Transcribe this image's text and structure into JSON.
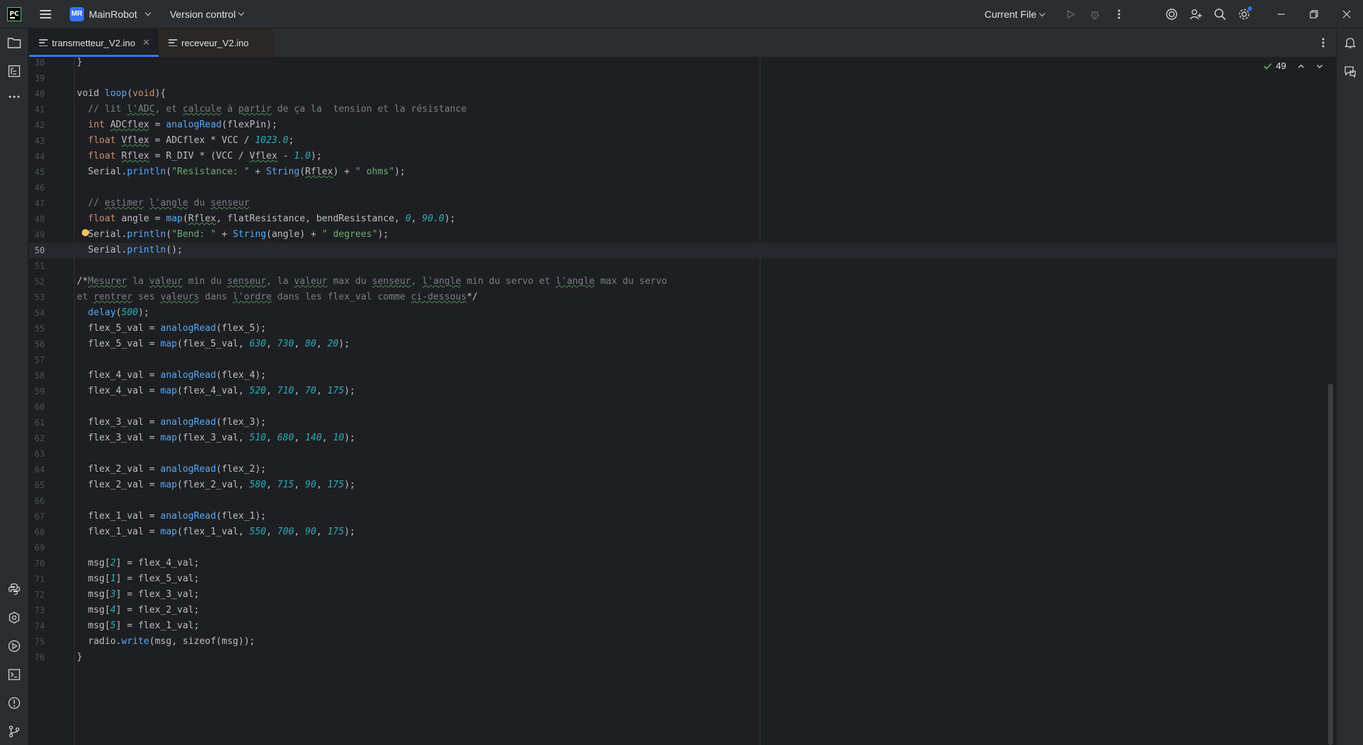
{
  "titlebar": {
    "app_logo": "PC",
    "project_badge": "MR",
    "project_name": "MainRobot",
    "vcs_label": "Version control",
    "run_config": "Current File"
  },
  "tabs": [
    {
      "label": "transmetteur_V2.ino",
      "active": true
    },
    {
      "label": "receveur_V2.ino",
      "active": false
    }
  ],
  "editor": {
    "inspection_count": "49",
    "current_line": "50",
    "lines": [
      {
        "n": "38",
        "t": [
          [
            "}",
            ""
          ]
        ]
      },
      {
        "n": "39",
        "t": []
      },
      {
        "n": "40",
        "t": [
          [
            "void ",
            ""
          ],
          [
            "loop",
            "fn"
          ],
          [
            "(",
            ""
          ],
          [
            "void",
            "kw"
          ],
          [
            "){",
            ""
          ]
        ]
      },
      {
        "n": "41",
        "t": [
          [
            "  // lit ",
            "cmt"
          ],
          [
            "l'ADC",
            "cmt ul"
          ],
          [
            ", et ",
            "cmt"
          ],
          [
            "calcule",
            "cmt ul"
          ],
          [
            " à ",
            "cmt"
          ],
          [
            "partir",
            "cmt ul"
          ],
          [
            " de ça la  tension et la résistance",
            "cmt"
          ]
        ]
      },
      {
        "n": "42",
        "t": [
          [
            "  ",
            ""
          ],
          [
            "int",
            "kw"
          ],
          [
            " ",
            ""
          ],
          [
            "ADCflex",
            "ul"
          ],
          [
            " = ",
            ""
          ],
          [
            "analogRead",
            "fn"
          ],
          [
            "(flexPin);",
            ""
          ]
        ]
      },
      {
        "n": "43",
        "t": [
          [
            "  ",
            ""
          ],
          [
            "float",
            "kw"
          ],
          [
            " ",
            ""
          ],
          [
            "Vflex",
            "ul"
          ],
          [
            " = ADCflex * VCC / ",
            ""
          ],
          [
            "1023.0",
            "num"
          ],
          [
            ";",
            ""
          ]
        ]
      },
      {
        "n": "44",
        "t": [
          [
            "  ",
            ""
          ],
          [
            "float",
            "kw"
          ],
          [
            " ",
            ""
          ],
          [
            "Rflex",
            "ul"
          ],
          [
            " = R_DIV * (VCC / ",
            ""
          ],
          [
            "Vflex",
            "ul"
          ],
          [
            " - ",
            ""
          ],
          [
            "1.0",
            "num"
          ],
          [
            ");",
            ""
          ]
        ]
      },
      {
        "n": "45",
        "t": [
          [
            "  Serial.",
            ""
          ],
          [
            "println",
            "fn"
          ],
          [
            "(",
            ""
          ],
          [
            "\"Resistance: \"",
            "str"
          ],
          [
            " + ",
            ""
          ],
          [
            "String",
            "fn"
          ],
          [
            "(",
            ""
          ],
          [
            "Rflex",
            "ul"
          ],
          [
            ") + ",
            ""
          ],
          [
            "\" ohms\"",
            "str"
          ],
          [
            ");",
            ""
          ]
        ]
      },
      {
        "n": "46",
        "t": []
      },
      {
        "n": "47",
        "t": [
          [
            "  // ",
            "cmt"
          ],
          [
            "estimer",
            "cmt ul"
          ],
          [
            " ",
            "cmt"
          ],
          [
            "l'angle",
            "cmt ul"
          ],
          [
            " du ",
            "cmt"
          ],
          [
            "senseur",
            "cmt ul"
          ]
        ]
      },
      {
        "n": "48",
        "t": [
          [
            "  ",
            ""
          ],
          [
            "float",
            "kw"
          ],
          [
            " angle = ",
            ""
          ],
          [
            "map",
            "fn"
          ],
          [
            "(",
            ""
          ],
          [
            "Rflex",
            "ul"
          ],
          [
            ", flatResistance, bendResistance, ",
            ""
          ],
          [
            "0",
            "num"
          ],
          [
            ", ",
            ""
          ],
          [
            "90.0",
            "num"
          ],
          [
            ");",
            ""
          ]
        ]
      },
      {
        "n": "49",
        "t": [
          [
            "  Serial.",
            ""
          ],
          [
            "println",
            "fn"
          ],
          [
            "(",
            ""
          ],
          [
            "\"Bend: \"",
            "str"
          ],
          [
            " + ",
            ""
          ],
          [
            "String",
            "fn"
          ],
          [
            "(angle) + ",
            ""
          ],
          [
            "\" degrees\"",
            "str"
          ],
          [
            ");",
            ""
          ]
        ]
      },
      {
        "n": "50",
        "t": [
          [
            "  Serial.",
            ""
          ],
          [
            "println",
            "fn"
          ],
          [
            "();",
            ""
          ]
        ]
      },
      {
        "n": "51",
        "t": []
      },
      {
        "n": "52",
        "t": [
          [
            "/*",
            ""
          ],
          [
            "Mesurer",
            "cmt ul"
          ],
          [
            " la ",
            "cmt"
          ],
          [
            "valeur",
            "cmt ul"
          ],
          [
            " min du ",
            "cmt"
          ],
          [
            "senseur",
            "cmt ul"
          ],
          [
            ", la ",
            "cmt"
          ],
          [
            "valeur",
            "cmt ul"
          ],
          [
            " max du ",
            "cmt"
          ],
          [
            "senseur",
            "cmt ul"
          ],
          [
            ", ",
            "cmt"
          ],
          [
            "l'angle",
            "cmt ul"
          ],
          [
            " min du servo et ",
            "cmt"
          ],
          [
            "l'angle",
            "cmt ul"
          ],
          [
            " max du servo",
            "cmt"
          ]
        ]
      },
      {
        "n": "53",
        "t": [
          [
            "et ",
            "cmt"
          ],
          [
            "rentrer",
            "cmt ul"
          ],
          [
            " ses ",
            "cmt"
          ],
          [
            "valeurs",
            "cmt ul"
          ],
          [
            " dans ",
            "cmt"
          ],
          [
            "l'ordre",
            "cmt ul"
          ],
          [
            " dans les flex_val comme ",
            "cmt"
          ],
          [
            "ci-dessous",
            "cmt ul"
          ],
          [
            "*/",
            ""
          ]
        ]
      },
      {
        "n": "54",
        "t": [
          [
            "  ",
            ""
          ],
          [
            "delay",
            "fn"
          ],
          [
            "(",
            ""
          ],
          [
            "500",
            "num"
          ],
          [
            ");",
            ""
          ]
        ]
      },
      {
        "n": "55",
        "t": [
          [
            "  flex_5_val = ",
            ""
          ],
          [
            "analogRead",
            "fn"
          ],
          [
            "(flex_5);",
            ""
          ]
        ]
      },
      {
        "n": "56",
        "t": [
          [
            "  flex_5_val = ",
            ""
          ],
          [
            "map",
            "fn"
          ],
          [
            "(flex_5_val, ",
            ""
          ],
          [
            "630",
            "num"
          ],
          [
            ", ",
            ""
          ],
          [
            "730",
            "num"
          ],
          [
            ", ",
            ""
          ],
          [
            "80",
            "num"
          ],
          [
            ", ",
            ""
          ],
          [
            "20",
            "num"
          ],
          [
            ");",
            ""
          ]
        ]
      },
      {
        "n": "57",
        "t": []
      },
      {
        "n": "58",
        "t": [
          [
            "  flex_4_val = ",
            ""
          ],
          [
            "analogRead",
            "fn"
          ],
          [
            "(flex_4);",
            ""
          ]
        ]
      },
      {
        "n": "59",
        "t": [
          [
            "  flex_4_val = ",
            ""
          ],
          [
            "map",
            "fn"
          ],
          [
            "(flex_4_val, ",
            ""
          ],
          [
            "520",
            "num"
          ],
          [
            ", ",
            ""
          ],
          [
            "710",
            "num"
          ],
          [
            ", ",
            ""
          ],
          [
            "70",
            "num"
          ],
          [
            ", ",
            ""
          ],
          [
            "175",
            "num"
          ],
          [
            ");",
            ""
          ]
        ]
      },
      {
        "n": "60",
        "t": []
      },
      {
        "n": "61",
        "t": [
          [
            "  flex_3_val = ",
            ""
          ],
          [
            "analogRead",
            "fn"
          ],
          [
            "(flex_3);",
            ""
          ]
        ]
      },
      {
        "n": "62",
        "t": [
          [
            "  flex_3_val = ",
            ""
          ],
          [
            "map",
            "fn"
          ],
          [
            "(flex_3_val, ",
            ""
          ],
          [
            "510",
            "num"
          ],
          [
            ", ",
            ""
          ],
          [
            "680",
            "num"
          ],
          [
            ", ",
            ""
          ],
          [
            "140",
            "num"
          ],
          [
            ", ",
            ""
          ],
          [
            "10",
            "num"
          ],
          [
            ");",
            ""
          ]
        ]
      },
      {
        "n": "63",
        "t": []
      },
      {
        "n": "64",
        "t": [
          [
            "  flex_2_val = ",
            ""
          ],
          [
            "analogRead",
            "fn"
          ],
          [
            "(flex_2);",
            ""
          ]
        ]
      },
      {
        "n": "65",
        "t": [
          [
            "  flex_2_val = ",
            ""
          ],
          [
            "map",
            "fn"
          ],
          [
            "(flex_2_val, ",
            ""
          ],
          [
            "580",
            "num"
          ],
          [
            ", ",
            ""
          ],
          [
            "715",
            "num"
          ],
          [
            ", ",
            ""
          ],
          [
            "90",
            "num"
          ],
          [
            ", ",
            ""
          ],
          [
            "175",
            "num"
          ],
          [
            ");",
            ""
          ]
        ]
      },
      {
        "n": "66",
        "t": []
      },
      {
        "n": "67",
        "t": [
          [
            "  flex_1_val = ",
            ""
          ],
          [
            "analogRead",
            "fn"
          ],
          [
            "(flex_1);",
            ""
          ]
        ]
      },
      {
        "n": "68",
        "t": [
          [
            "  flex_1_val = ",
            ""
          ],
          [
            "map",
            "fn"
          ],
          [
            "(flex_1_val, ",
            ""
          ],
          [
            "550",
            "num"
          ],
          [
            ", ",
            ""
          ],
          [
            "700",
            "num"
          ],
          [
            ", ",
            ""
          ],
          [
            "90",
            "num"
          ],
          [
            ", ",
            ""
          ],
          [
            "175",
            "num"
          ],
          [
            ");",
            ""
          ]
        ]
      },
      {
        "n": "69",
        "t": []
      },
      {
        "n": "70",
        "t": [
          [
            "  msg[",
            ""
          ],
          [
            "2",
            "num"
          ],
          [
            "] = flex_4_val;",
            ""
          ]
        ]
      },
      {
        "n": "71",
        "t": [
          [
            "  msg[",
            ""
          ],
          [
            "1",
            "num"
          ],
          [
            "] = flex_5_val;",
            ""
          ]
        ]
      },
      {
        "n": "72",
        "t": [
          [
            "  msg[",
            ""
          ],
          [
            "3",
            "num"
          ],
          [
            "] = flex_3_val;",
            ""
          ]
        ]
      },
      {
        "n": "73",
        "t": [
          [
            "  msg[",
            ""
          ],
          [
            "4",
            "num"
          ],
          [
            "] = flex_2_val;",
            ""
          ]
        ]
      },
      {
        "n": "74",
        "t": [
          [
            "  msg[",
            ""
          ],
          [
            "5",
            "num"
          ],
          [
            "] = flex_1_val;",
            ""
          ]
        ]
      },
      {
        "n": "75",
        "t": [
          [
            "  radio.",
            ""
          ],
          [
            "write",
            "fn"
          ],
          [
            "(msg, sizeof(msg));",
            ""
          ]
        ]
      },
      {
        "n": "76",
        "t": [
          [
            "}",
            ""
          ]
        ]
      }
    ]
  }
}
